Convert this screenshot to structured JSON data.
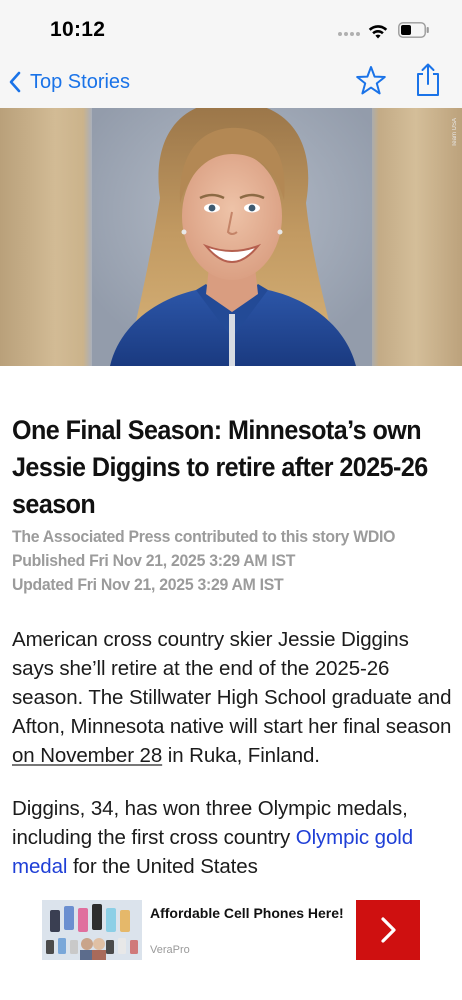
{
  "status_bar": {
    "time": "10:12"
  },
  "nav": {
    "back_label": "Top Stories",
    "accent_color": "#1a73e8"
  },
  "hero": {
    "credit": "Team USA"
  },
  "article": {
    "headline": "One Final Season: Minnesota’s own Jessie Diggins to retire after 2025-26 season",
    "byline": "The Associated Press contributed to this story WDIO",
    "published": "Published Fri Nov 21, 2025 3:29 AM IST",
    "updated": "Updated Fri Nov 21, 2025 3:29 AM IST",
    "p1_text": "American cross country skier Jessie Diggins says she’ll retire at the end of the 2025-26 season. The Stillwater High School graduate and Afton, Minnesota native will start her final season ",
    "p1_link": "on November 28",
    "p1_tail": " in Ruka, Finland.",
    "p2_text": "Diggins, 34, has won three Olympic medals, including the first cross country ",
    "p2_link": "Olympic gold medal",
    "p2_tail": " for the United States"
  },
  "ad": {
    "title": "Affordable Cell Phones Here!",
    "source": "VeraPro",
    "cta_color": "#cf1010"
  },
  "icons": {
    "back": "chevron-left-icon",
    "favorite": "star-icon",
    "share": "share-icon",
    "wifi": "wifi-icon",
    "battery": "battery-icon",
    "ad_cta": "chevron-right-icon"
  }
}
